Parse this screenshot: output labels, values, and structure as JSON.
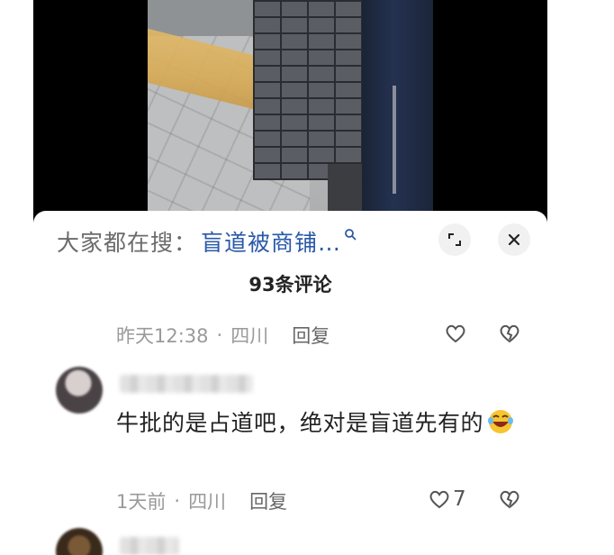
{
  "search_bar": {
    "prefix": "大家都在搜：",
    "link_text": "盲道被商铺…",
    "icon": "search-icon"
  },
  "header_buttons": {
    "expand_icon": "expand-icon",
    "close_icon": "close-icon"
  },
  "comments_header": {
    "count_label": "93条评论"
  },
  "comments": [
    {
      "time": "昨天12:38",
      "location": "四川",
      "reply_label": "回复",
      "like_count": "",
      "like_icon": "heart-icon",
      "dislike_icon": "broken-heart-icon"
    },
    {
      "username_blurred": true,
      "text": "牛批的是占道吧，绝对是盲道先有的",
      "emoji": "rofl-emoji",
      "time": "1天前",
      "location": "四川",
      "reply_label": "回复",
      "like_count": "7",
      "like_icon": "heart-icon",
      "dislike_icon": "broken-heart-icon"
    },
    {
      "username_blurred": true
    }
  ],
  "colors": {
    "link": "#2a59a8",
    "meta_text": "#9a9a9a",
    "button_bg": "#f1f1f1",
    "video_bg": "#000000"
  }
}
